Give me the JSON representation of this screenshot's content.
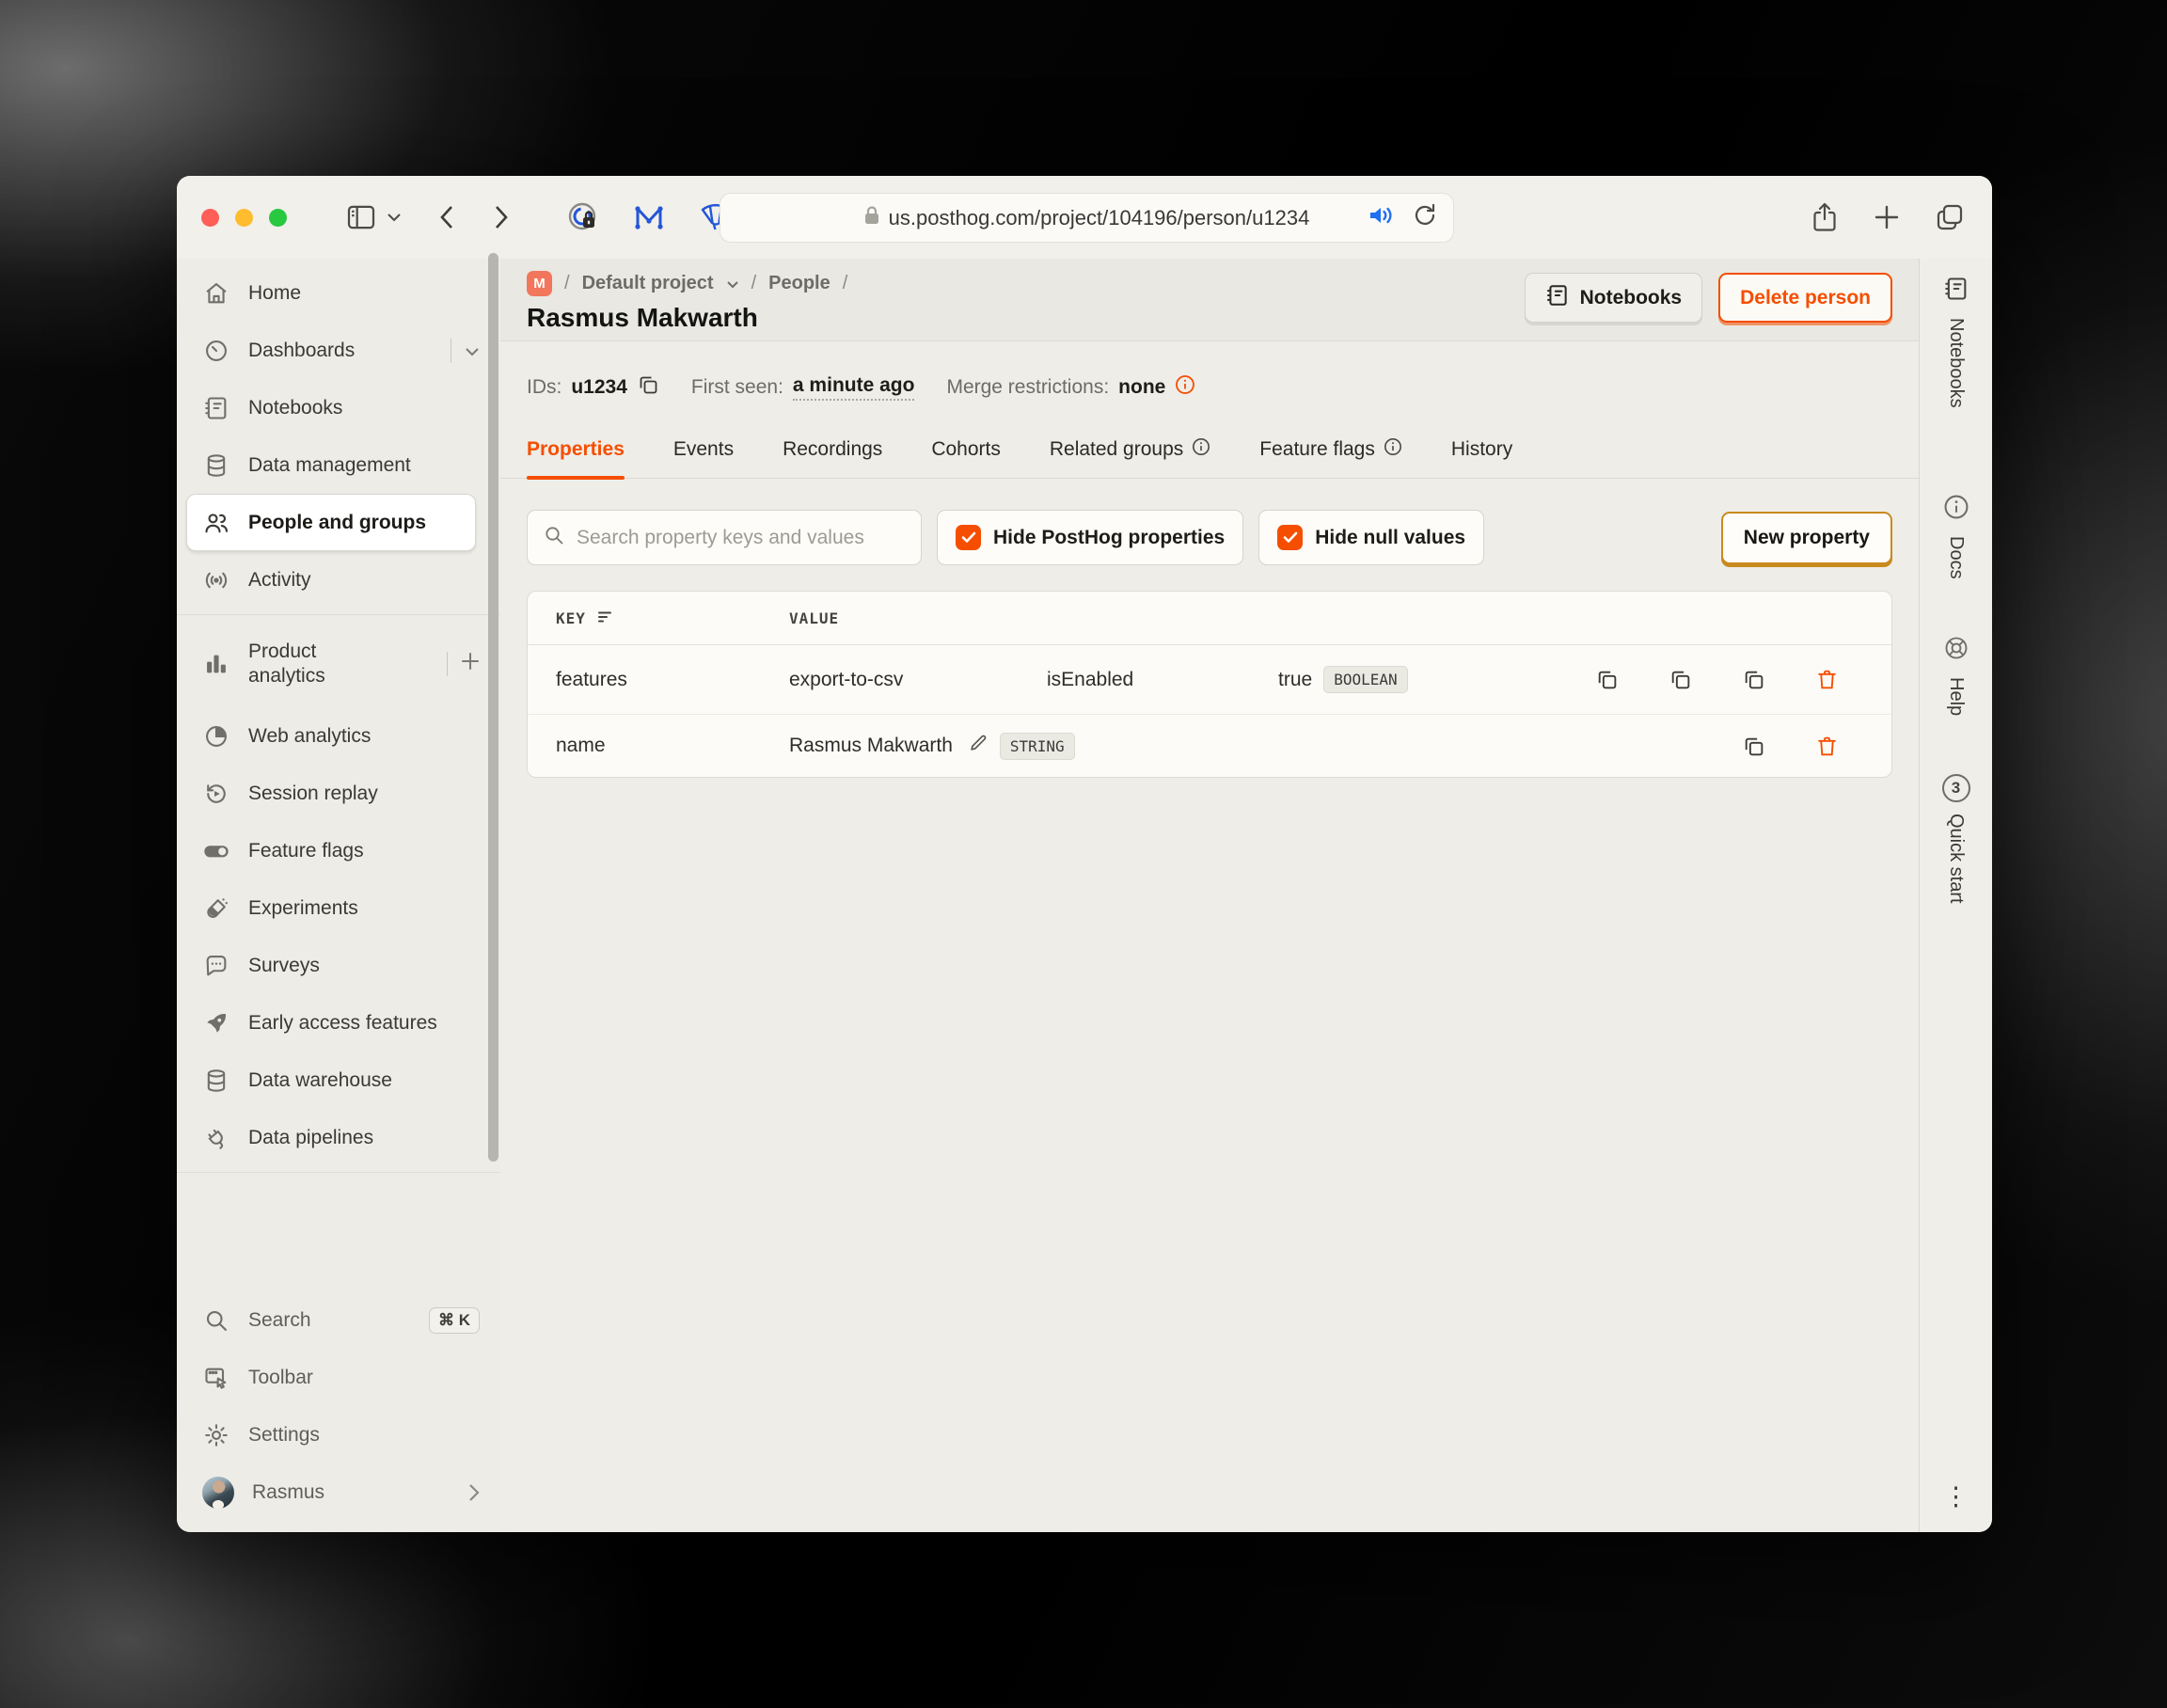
{
  "browser": {
    "url": "us.posthog.com/project/104196/person/u1234"
  },
  "colors": {
    "accent": "#f54e00",
    "breadcrumb_badge_bg": "#f2765c",
    "traffic_red": "#ff5f57",
    "traffic_yellow": "#febc2e",
    "traffic_green": "#28c840",
    "extension_blue": "#2456d6",
    "checkbox_checked": "#f54e00"
  },
  "breadcrumb": {
    "badge": "M",
    "sep": "/",
    "project": "Default project",
    "section": "People"
  },
  "header": {
    "title": "Rasmus Makwarth",
    "notebooks_button": "Notebooks",
    "delete_button": "Delete person"
  },
  "meta": {
    "ids_label": "IDs:",
    "id_value": "u1234",
    "first_seen_label": "First seen:",
    "first_seen_value": "a minute ago",
    "merge_label": "Merge restrictions:",
    "merge_value": "none"
  },
  "tabs": {
    "items": [
      {
        "label": "Properties"
      },
      {
        "label": "Events"
      },
      {
        "label": "Recordings"
      },
      {
        "label": "Cohorts"
      },
      {
        "label": "Related groups"
      },
      {
        "label": "Feature flags"
      },
      {
        "label": "History"
      }
    ]
  },
  "filters": {
    "search_placeholder": "Search property keys and values",
    "hide_posthog": "Hide PostHog properties",
    "hide_null": "Hide null values",
    "new_property": "New property"
  },
  "table": {
    "key_header": "KEY",
    "value_header": "VALUE",
    "rows": [
      {
        "key": "features",
        "col1": "export-to-csv",
        "col2": "isEnabled",
        "col3": "true",
        "type": "BOOLEAN"
      },
      {
        "key": "name",
        "col1": "Rasmus Makwarth",
        "type": "STRING"
      }
    ]
  },
  "sidebar": {
    "items": [
      {
        "label": "Home"
      },
      {
        "label": "Dashboards"
      },
      {
        "label": "Notebooks"
      },
      {
        "label": "Data management"
      },
      {
        "label": "People and groups"
      },
      {
        "label": "Activity"
      },
      {
        "label": "Product analytics"
      },
      {
        "label": "Web analytics"
      },
      {
        "label": "Session replay"
      },
      {
        "label": "Feature flags"
      },
      {
        "label": "Experiments"
      },
      {
        "label": "Surveys"
      },
      {
        "label": "Early access features"
      },
      {
        "label": "Data warehouse"
      },
      {
        "label": "Data pipelines"
      }
    ],
    "bottom": [
      {
        "label": "Search",
        "shortcut": "⌘ K"
      },
      {
        "label": "Toolbar"
      },
      {
        "label": "Settings"
      },
      {
        "label": "Rasmus"
      }
    ]
  },
  "right_rail": {
    "items": [
      {
        "label": "Notebooks"
      },
      {
        "label": "Docs"
      },
      {
        "label": "Help"
      },
      {
        "label": "Quick start"
      }
    ],
    "quick_start_badge": "3",
    "kebab": "⋮"
  }
}
